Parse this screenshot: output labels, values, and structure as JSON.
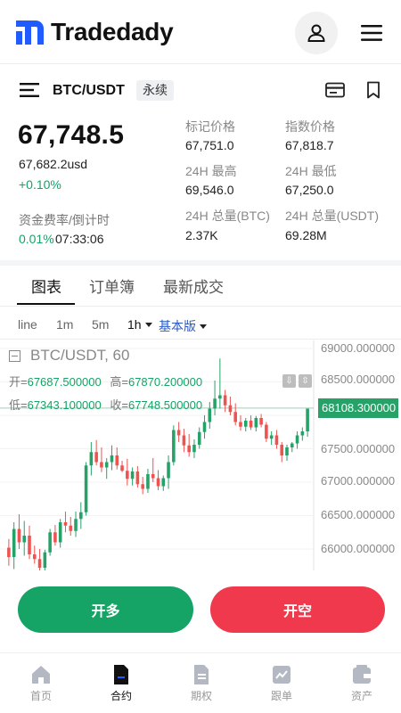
{
  "app": {
    "brand": "Tradedady"
  },
  "pair": {
    "name": "BTC/USDT",
    "tag": "永续"
  },
  "ticker": {
    "price": "67,748.5",
    "price_usd": "67,682.2usd",
    "change": "+0.10%",
    "funding_label": "资金费率/倒计时",
    "funding_rate": "0.01%",
    "countdown": "07:33:06",
    "stats": [
      {
        "label": "标记价格",
        "value": "67,751.0"
      },
      {
        "label": "指数价格",
        "value": "67,818.7"
      },
      {
        "label": "24H 最高",
        "value": "69,546.0"
      },
      {
        "label": "24H 最低",
        "value": "67,250.0"
      },
      {
        "label": "24H 总量(BTC)",
        "value": "2.37K"
      },
      {
        "label": "24H 总量(USDT)",
        "value": "69.28M"
      }
    ]
  },
  "tabs": [
    "图表",
    "订单簿",
    "最新成交"
  ],
  "intervals": {
    "items": [
      "line",
      "1m",
      "5m",
      "1h"
    ],
    "active": "1h",
    "mode": "基本版"
  },
  "chart_data": {
    "type": "candlestick",
    "title": "BTC/USDT, 60",
    "ohlc_labels": {
      "open": "开=",
      "high": "高=",
      "low": "低=",
      "close": "收="
    },
    "ohlc": {
      "open": "67687.500000",
      "high": "67870.200000",
      "low": "67343.100000",
      "close": "67748.500000"
    },
    "last_price": "68108.300000",
    "y_ticks": [
      "69000.000000",
      "68500.000000",
      "68000.000000",
      "67500.000000",
      "67000.000000",
      "66500.000000",
      "66000.000000"
    ],
    "y_values": [
      69000,
      68500,
      68000,
      67500,
      67000,
      66500,
      66000
    ],
    "candles": [
      {
        "o": 66020,
        "h": 66150,
        "l": 65750,
        "c": 65880
      },
      {
        "o": 65880,
        "h": 66400,
        "l": 65700,
        "c": 66300
      },
      {
        "o": 66300,
        "h": 66520,
        "l": 66000,
        "c": 66100
      },
      {
        "o": 66100,
        "h": 66420,
        "l": 65900,
        "c": 66200
      },
      {
        "o": 66200,
        "h": 66350,
        "l": 65850,
        "c": 65920
      },
      {
        "o": 65920,
        "h": 66050,
        "l": 65780,
        "c": 65850
      },
      {
        "o": 65850,
        "h": 66000,
        "l": 65660,
        "c": 65720
      },
      {
        "o": 65720,
        "h": 65990,
        "l": 65620,
        "c": 65950
      },
      {
        "o": 65950,
        "h": 66300,
        "l": 65900,
        "c": 66250
      },
      {
        "o": 66250,
        "h": 66360,
        "l": 66050,
        "c": 66100
      },
      {
        "o": 66100,
        "h": 66450,
        "l": 66020,
        "c": 66400
      },
      {
        "o": 66400,
        "h": 66560,
        "l": 66250,
        "c": 66350
      },
      {
        "o": 66350,
        "h": 66480,
        "l": 66200,
        "c": 66270
      },
      {
        "o": 66270,
        "h": 66560,
        "l": 66180,
        "c": 66450
      },
      {
        "o": 66450,
        "h": 66700,
        "l": 66300,
        "c": 66550
      },
      {
        "o": 66550,
        "h": 67300,
        "l": 66500,
        "c": 67250
      },
      {
        "o": 67250,
        "h": 67600,
        "l": 67100,
        "c": 67450
      },
      {
        "o": 67450,
        "h": 67630,
        "l": 67250,
        "c": 67300
      },
      {
        "o": 67300,
        "h": 67520,
        "l": 67150,
        "c": 67220
      },
      {
        "o": 67220,
        "h": 67360,
        "l": 67050,
        "c": 67300
      },
      {
        "o": 67300,
        "h": 67550,
        "l": 67180,
        "c": 67400
      },
      {
        "o": 67400,
        "h": 67520,
        "l": 67190,
        "c": 67250
      },
      {
        "o": 67250,
        "h": 67320,
        "l": 67150,
        "c": 67170
      },
      {
        "o": 67170,
        "h": 67350,
        "l": 66950,
        "c": 67050
      },
      {
        "o": 67050,
        "h": 67220,
        "l": 66950,
        "c": 67160
      },
      {
        "o": 67160,
        "h": 67240,
        "l": 66920,
        "c": 66970
      },
      {
        "o": 66970,
        "h": 67080,
        "l": 66820,
        "c": 66900
      },
      {
        "o": 66900,
        "h": 67200,
        "l": 66840,
        "c": 67120
      },
      {
        "o": 67120,
        "h": 67360,
        "l": 67000,
        "c": 67060
      },
      {
        "o": 67060,
        "h": 67180,
        "l": 66880,
        "c": 66940
      },
      {
        "o": 66940,
        "h": 67100,
        "l": 66870,
        "c": 67060
      },
      {
        "o": 67060,
        "h": 67400,
        "l": 66900,
        "c": 67300
      },
      {
        "o": 67300,
        "h": 67850,
        "l": 67250,
        "c": 67780
      },
      {
        "o": 67780,
        "h": 67900,
        "l": 67600,
        "c": 67700
      },
      {
        "o": 67700,
        "h": 67800,
        "l": 67450,
        "c": 67550
      },
      {
        "o": 67550,
        "h": 67720,
        "l": 67380,
        "c": 67450
      },
      {
        "o": 67450,
        "h": 67640,
        "l": 67360,
        "c": 67560
      },
      {
        "o": 67560,
        "h": 67820,
        "l": 67500,
        "c": 67750
      },
      {
        "o": 67750,
        "h": 68000,
        "l": 67650,
        "c": 67900
      },
      {
        "o": 67900,
        "h": 68200,
        "l": 67800,
        "c": 68100
      },
      {
        "o": 68100,
        "h": 68520,
        "l": 68000,
        "c": 68250
      },
      {
        "o": 68250,
        "h": 68850,
        "l": 68100,
        "c": 68300
      },
      {
        "o": 68300,
        "h": 68380,
        "l": 68050,
        "c": 68150
      },
      {
        "o": 68150,
        "h": 68280,
        "l": 68000,
        "c": 68050
      },
      {
        "o": 68050,
        "h": 68180,
        "l": 67850,
        "c": 67900
      },
      {
        "o": 67900,
        "h": 68000,
        "l": 67770,
        "c": 67830
      },
      {
        "o": 67830,
        "h": 67960,
        "l": 67760,
        "c": 67920
      },
      {
        "o": 67920,
        "h": 68000,
        "l": 67780,
        "c": 67820
      },
      {
        "o": 67820,
        "h": 67990,
        "l": 67760,
        "c": 67960
      },
      {
        "o": 67960,
        "h": 68020,
        "l": 67820,
        "c": 67860
      },
      {
        "o": 67860,
        "h": 67900,
        "l": 67600,
        "c": 67650
      },
      {
        "o": 67650,
        "h": 67760,
        "l": 67560,
        "c": 67700
      },
      {
        "o": 67700,
        "h": 67780,
        "l": 67500,
        "c": 67560
      },
      {
        "o": 67560,
        "h": 67600,
        "l": 67300,
        "c": 67400
      },
      {
        "o": 67400,
        "h": 67560,
        "l": 67320,
        "c": 67520
      },
      {
        "o": 67520,
        "h": 67600,
        "l": 67450,
        "c": 67580
      },
      {
        "o": 67580,
        "h": 67760,
        "l": 67500,
        "c": 67700
      },
      {
        "o": 67700,
        "h": 67820,
        "l": 67620,
        "c": 67760
      },
      {
        "o": 67760,
        "h": 67980,
        "l": 67680,
        "c": 68100
      }
    ],
    "colors": {
      "up": "#26a269",
      "down": "#ef5350"
    }
  },
  "actions": {
    "buy": "开多",
    "sell": "开空"
  },
  "nav": [
    {
      "label": "首页",
      "icon": "home-icon",
      "active": false
    },
    {
      "label": "合约",
      "icon": "contract-icon",
      "active": true
    },
    {
      "label": "期权",
      "icon": "options-icon",
      "active": false
    },
    {
      "label": "跟单",
      "icon": "copy-trade-icon",
      "active": false
    },
    {
      "label": "资产",
      "icon": "wallet-icon",
      "active": false
    }
  ],
  "colors": {
    "brand": "#1f5bff",
    "up": "#16a366",
    "down": "#f0394d"
  }
}
